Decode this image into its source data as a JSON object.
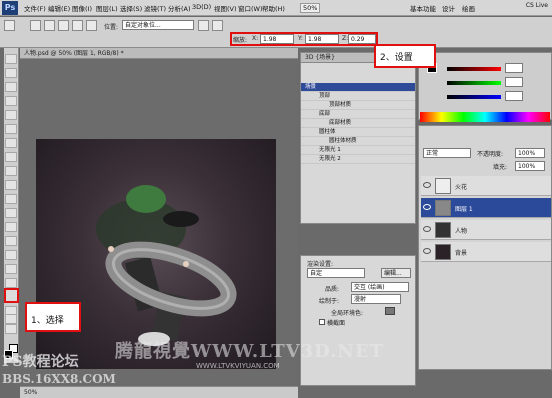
{
  "app": {
    "logo": "Ps"
  },
  "menubar": {
    "items": [
      "文件(F)",
      "编辑(E)",
      "图像(I)",
      "图层(L)",
      "选择(S)",
      "滤镜(T)",
      "分析(A)",
      "3D(D)",
      "视图(V)",
      "窗口(W)",
      "帮助(H)"
    ],
    "zoom": "50%",
    "workspaces": [
      "基本功能",
      "设计",
      "绘画"
    ],
    "cs_live": "CS Live"
  },
  "options": {
    "position_label": "位置:",
    "position_value": "自定对象位...",
    "scale_label": "缩放:",
    "x_label": "X:",
    "x_value": "1.98",
    "y_label": "Y:",
    "y_value": "1.98",
    "z_label": "Z:",
    "z_value": "0.29"
  },
  "document": {
    "tab": "人物.psd @ 50% (图层 1, RGB/8) *",
    "status": "50%"
  },
  "panel3d": {
    "tabs": "3D {场景}",
    "rows": [
      {
        "label": "场景",
        "selected": true
      },
      {
        "label": "顶部",
        "selected": false
      },
      {
        "label": "顶部材质",
        "selected": false
      },
      {
        "label": "底部",
        "selected": false
      },
      {
        "label": "底部材质",
        "selected": false
      },
      {
        "label": "圆柱体",
        "selected": false
      },
      {
        "label": "圆柱体材质",
        "selected": false
      },
      {
        "label": "无限光 1",
        "selected": false
      },
      {
        "label": "无限光 2",
        "selected": false
      }
    ]
  },
  "render": {
    "title": "渲染设置:",
    "preset": "自定",
    "edit_btn": "编辑...",
    "quality_label": "品质:",
    "quality_value": "交互 (绘画)",
    "paint_on_label": "绘制于:",
    "paint_on_value": "漫射",
    "global_label": "全局环境色:",
    "cross_section": "横截面"
  },
  "layers": {
    "blend": "正常",
    "opacity_label": "不透明度:",
    "opacity": "100%",
    "fill_label": "填充:",
    "fill": "100%",
    "items": [
      {
        "name": "火花",
        "selected": false
      },
      {
        "name": "图层 1",
        "selected": true
      },
      {
        "name": "人物",
        "selected": false
      },
      {
        "name": "背景",
        "selected": false
      }
    ]
  },
  "callouts": {
    "step1": "1、选择",
    "step2": "2、设置"
  },
  "watermark": {
    "main": "腾龍視覺WWW.LTV3D.NET",
    "logo": "PS教程论坛",
    "logo2": "BBS.16XX8.COM",
    "url": "WWW.LTVKVIYUAN.COM"
  },
  "colors": {
    "highlight": "#e01010",
    "selection": "#2b4a9a"
  }
}
